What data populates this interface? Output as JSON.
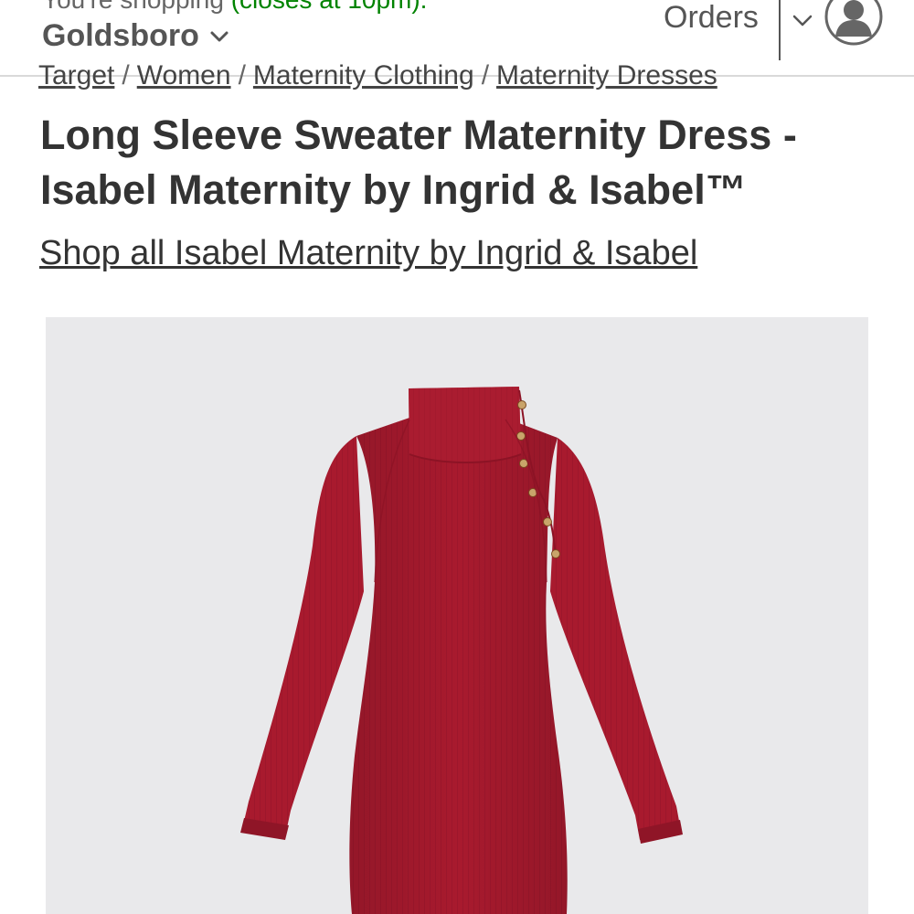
{
  "header": {
    "store_line_prefix": "You're shopping ",
    "store_hours": "(closes at 10pm).",
    "store_name": "Goldsboro",
    "orders_label": "Orders"
  },
  "breadcrumb": {
    "items": [
      "Target",
      "Women",
      "Maternity Clothing",
      "Maternity Dresses"
    ],
    "separator": "/"
  },
  "product": {
    "title": "Long Sleeve Sweater Maternity Dress - Isabel Maternity by Ingrid & Isabel™",
    "shop_all_link": "Shop all Isabel Maternity by Ingrid & Isabel"
  },
  "colors": {
    "store_hours_green": "#008300",
    "image_background": "#e9e9eb",
    "dress_red": "#a81a2e",
    "text": "#333333"
  },
  "icons": {
    "store_chevron": "chevron-down-icon",
    "account_chevron": "chevron-down-icon",
    "account": "user-avatar-icon"
  }
}
